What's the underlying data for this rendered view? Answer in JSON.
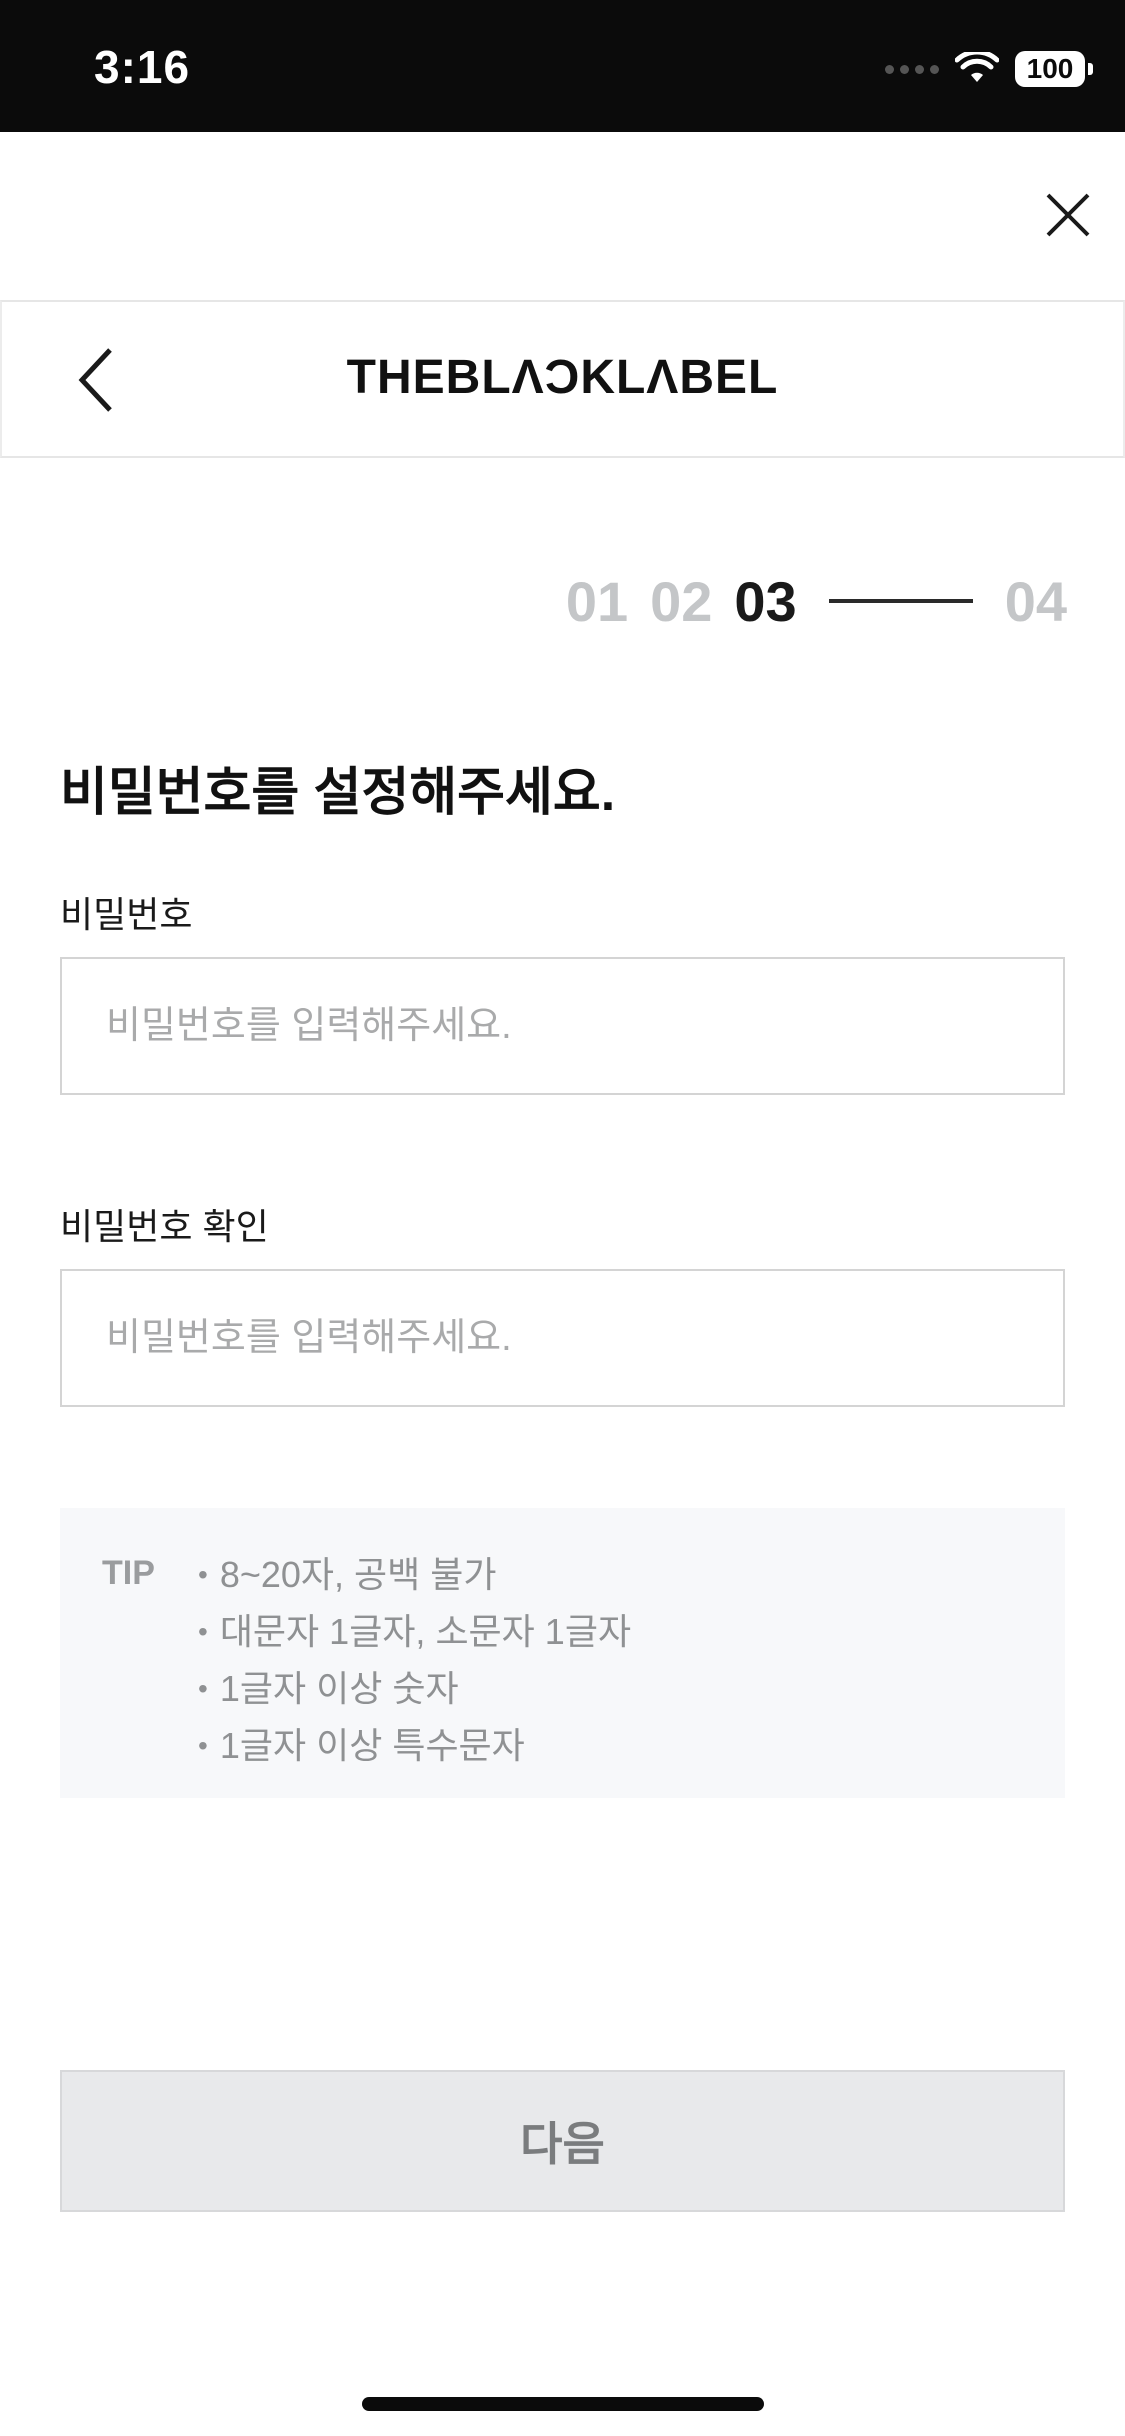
{
  "status_bar": {
    "time": "3:16",
    "battery": "100",
    "icons": [
      "signal-dots-icon",
      "wifi-icon",
      "battery-icon"
    ]
  },
  "header": {
    "brand": "THEBLΛƆKLΛBEL",
    "back_icon": "chevron-left-icon",
    "close_icon": "close-icon"
  },
  "steps": {
    "items": [
      "01",
      "02",
      "03",
      "04"
    ],
    "active_index": 2
  },
  "form": {
    "title": "비밀번호를 설정해주세요.",
    "password": {
      "label": "비밀번호",
      "placeholder": "비밀번호를 입력해주세요.",
      "value": ""
    },
    "password_confirm": {
      "label": "비밀번호 확인",
      "placeholder": "비밀번호를 입력해주세요.",
      "value": ""
    }
  },
  "tip": {
    "label": "TIP",
    "items": [
      "8~20자, 공백 불가",
      "대문자 1글자, 소문자 1글자",
      "1글자 이상 숫자",
      "1글자 이상 특수문자"
    ]
  },
  "actions": {
    "next_label": "다음"
  },
  "colors": {
    "status_bar_bg": "#0b0b0b",
    "active_step": "#1a1a1a",
    "inactive_step": "#c4c6c8",
    "tip_bg": "#f7f8fa",
    "button_disabled_bg": "#e8e9eb"
  }
}
